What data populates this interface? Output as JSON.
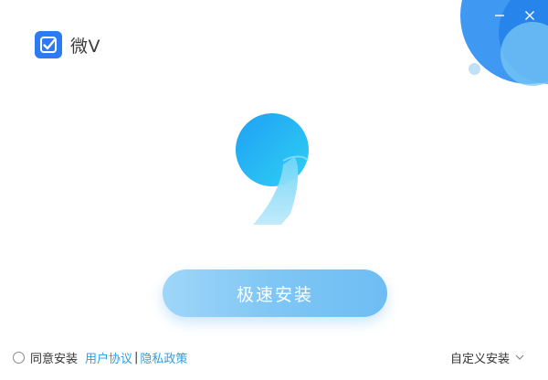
{
  "app": {
    "name": "微V",
    "brand_color": "#2d7bf2",
    "accent_color": "#2b9fe0"
  },
  "window_controls": {
    "minimize_icon": "minimize-icon",
    "close_icon": "close-icon"
  },
  "main": {
    "install_button_label": "极速安装"
  },
  "footer": {
    "agree_label": "同意安装",
    "user_agreement_link": "用户协议",
    "separator": "|",
    "privacy_link": "隐私政策",
    "custom_install_label": "自定义安装"
  }
}
